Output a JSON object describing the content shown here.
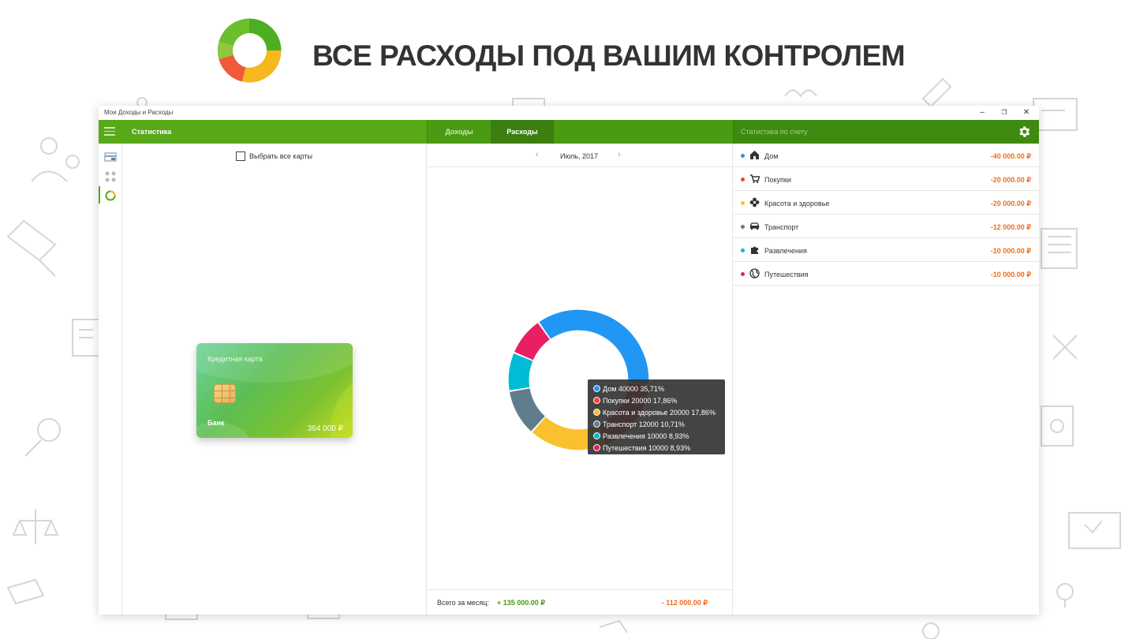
{
  "hero": {
    "title": "ВСЕ РАСХОДЫ ПОД ВАШИМ КОНТРОЛЕМ",
    "logo_icon": "donut-logo-icon"
  },
  "window": {
    "title": "Мои Доходы и Расходы",
    "controls": {
      "minimize": "–",
      "maximize": "❐",
      "close": "✕"
    }
  },
  "toolbar": {
    "menu_icon": "hamburger-icon",
    "section_title": "Статистика",
    "tabs": [
      {
        "label": "Доходы",
        "active": false
      },
      {
        "label": "Расходы",
        "active": true
      }
    ],
    "account_stats_label": "Статистика по счету",
    "settings_icon": "gear-icon"
  },
  "leftnav": {
    "items": [
      "cards-icon",
      "categories-icon",
      "statistics-icon"
    ],
    "active_index": 2
  },
  "cards_panel": {
    "select_all_label": "Выбрать все карты",
    "select_all_checked": false,
    "card": {
      "name": "Кредитная карта",
      "bank": "Банк",
      "balance": "364 000 ₽"
    }
  },
  "month_nav": {
    "prev": "‹",
    "label": "Июль, 2017",
    "next": "›"
  },
  "chart_data": {
    "type": "pie",
    "style": "donut",
    "categories": [
      "Дом",
      "Покупки",
      "Красота и здоровье",
      "Транспорт",
      "Развлечения",
      "Путешествия"
    ],
    "values": [
      40000,
      20000,
      20000,
      12000,
      10000,
      10000
    ],
    "percentages": [
      "35,71%",
      "17,86%",
      "17,86%",
      "10,71%",
      "8,93%",
      "8,93%"
    ],
    "colors": [
      "#2196f3",
      "#f44336",
      "#fbc02d",
      "#607d8b",
      "#00bcd4",
      "#e91e63"
    ],
    "tooltip_rows": [
      "Дом 40000 35,71%",
      "Покупки 20000 17,86%",
      "Красота и здоровье 20000 17,86%",
      "Транспорт 12000 10,71%",
      "Развлечения 10000 8,93%",
      "Путешествия 10000 8,93%"
    ]
  },
  "totals": {
    "label": "Всего за месяц:",
    "income": "+ 135 000.00 ₽",
    "expense": "- 112 000.00 ₽"
  },
  "categories": [
    {
      "name": "Дом",
      "amount": "-40 000.00 ₽",
      "color": "#2196f3",
      "icon": "house-icon"
    },
    {
      "name": "Покупки",
      "amount": "-20 000.00 ₽",
      "color": "#f44336",
      "icon": "cart-icon"
    },
    {
      "name": "Красота и здоровье",
      "amount": "-20 000.00 ₽",
      "color": "#fbc02d",
      "icon": "flower-icon"
    },
    {
      "name": "Транспорт",
      "amount": "-12 000.00 ₽",
      "color": "#607d8b",
      "icon": "car-icon"
    },
    {
      "name": "Развлечения",
      "amount": "-10 000.00 ₽",
      "color": "#00bcd4",
      "icon": "puzzle-icon"
    },
    {
      "name": "Путешествия",
      "amount": "-10 000.00 ₽",
      "color": "#e91e63",
      "icon": "globe-icon"
    }
  ]
}
